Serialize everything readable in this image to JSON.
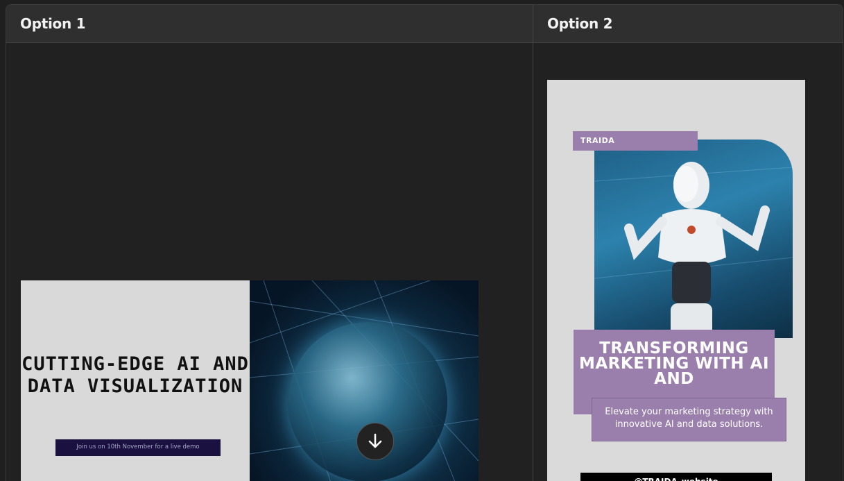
{
  "columns": [
    {
      "title": "Option 1"
    },
    {
      "title": "Option 2"
    }
  ],
  "option1": {
    "headline": "CUTTING-EDGE AI AND DATA VISUALIZATION",
    "ribbon_text": "Join us on 10th November for a live demo",
    "image": "digital-globe-network",
    "download_icon": "arrow-down-icon"
  },
  "option2": {
    "brand": "TRAIDA",
    "image": "humanoid-robot",
    "headline": "TRANSFORMING MARKETING WITH AI AND",
    "subtext": "Elevate your marketing strategy with innovative AI and data solutions.",
    "bottom_text": "@TRAIDA_website",
    "accent": "#9a7fad"
  },
  "colors": {
    "background": "#212121",
    "header": "#2f2f2f",
    "card_grey": "#d9d9d9",
    "ribbon": "#1a1140"
  }
}
